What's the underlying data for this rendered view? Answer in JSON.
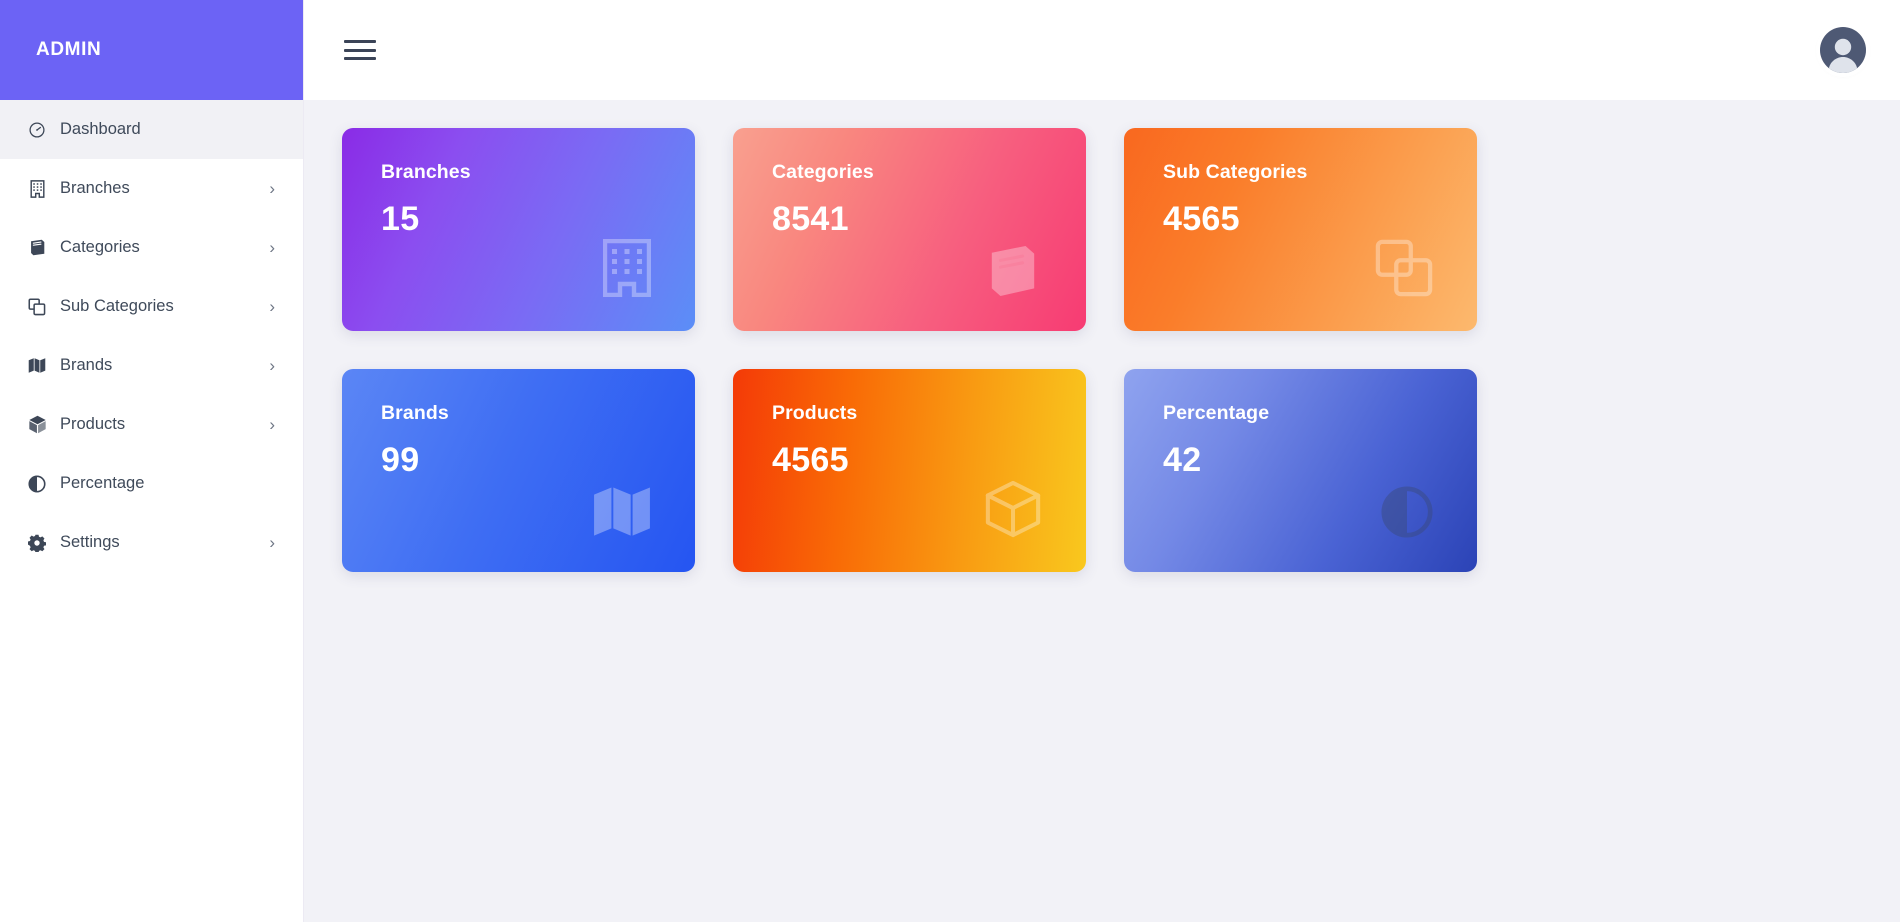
{
  "sidebar": {
    "brand": "ADMIN",
    "items": [
      {
        "label": "Dashboard",
        "icon": "dashboard-icon",
        "active": true,
        "caret": ""
      },
      {
        "label": "Branches",
        "icon": "building-icon",
        "active": false,
        "caret": "›"
      },
      {
        "label": "Categories",
        "icon": "book-icon",
        "active": false,
        "caret": "›"
      },
      {
        "label": "Sub Categories",
        "icon": "copy-icon",
        "active": false,
        "caret": "›"
      },
      {
        "label": "Brands",
        "icon": "map-icon",
        "active": false,
        "caret": "›"
      },
      {
        "label": "Products",
        "icon": "cube-icon",
        "active": false,
        "caret": "›"
      },
      {
        "label": "Percentage",
        "icon": "half-circle-icon",
        "active": false,
        "caret": ""
      },
      {
        "label": "Settings",
        "icon": "gear-icon",
        "active": false,
        "caret": "›"
      }
    ]
  },
  "topbar": {
    "menu_toggle": "hamburger-menu-icon",
    "avatar": "user-avatar"
  },
  "cards": [
    {
      "title": "Branches",
      "value": "15",
      "icon": "building-icon",
      "accent": "#7a6bf4"
    },
    {
      "title": "Categories",
      "value": "8541",
      "icon": "book-icon",
      "accent": "#f75f7f"
    },
    {
      "title": "Sub Categories",
      "value": "4565",
      "icon": "copy-icon",
      "accent": "#fa7d2a"
    },
    {
      "title": "Brands",
      "value": "99",
      "icon": "map-icon",
      "accent": "#3f6ef3"
    },
    {
      "title": "Products",
      "value": "4565",
      "icon": "cube-icon",
      "accent": "#f96a06"
    },
    {
      "title": "Percentage",
      "value": "42",
      "icon": "half-circle-icon",
      "accent": "#4a63d4"
    }
  ],
  "colors": {
    "brand_purple": "#6c63f5",
    "content_bg": "#f2f2f7",
    "sidebar_bg": "#ffffff",
    "active_row": "#f1f1f5",
    "text_primary": "#3f4a5a"
  }
}
